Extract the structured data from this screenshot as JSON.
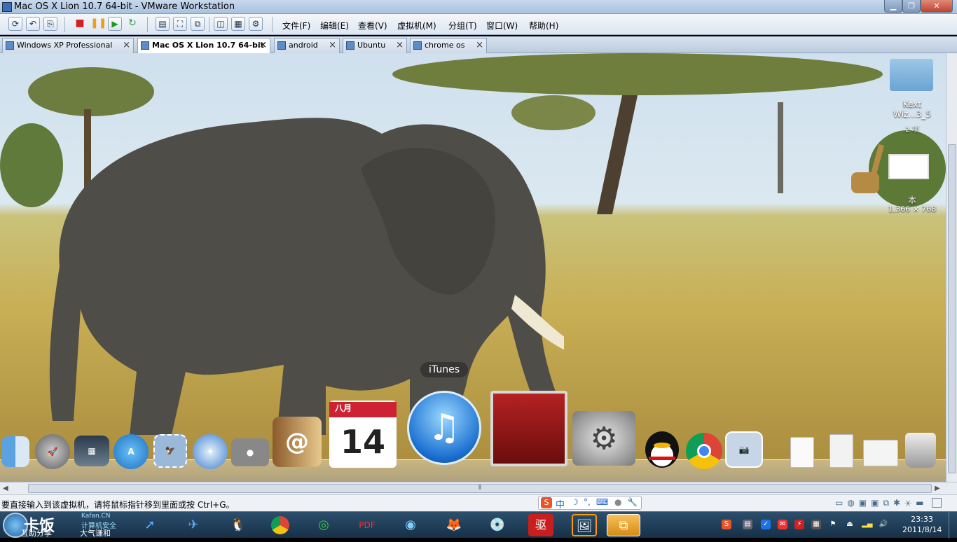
{
  "window": {
    "title": "Mac OS X Lion 10.7 64-bit - VMware Workstation",
    "controls": [
      "minimize",
      "maximize",
      "close"
    ]
  },
  "toolbar": {
    "menus": [
      "文件(F)",
      "编辑(E)",
      "查看(V)",
      "虚拟机(M)",
      "分组(T)",
      "窗口(W)",
      "帮助(H)"
    ]
  },
  "tabs": [
    {
      "label": "Windows XP Professional",
      "active": false
    },
    {
      "label": "Mac OS X Lion 10.7 64-bit",
      "active": true
    },
    {
      "label": "android",
      "active": false
    },
    {
      "label": "Ubuntu",
      "active": false
    },
    {
      "label": "chrome os",
      "active": false
    }
  ],
  "desktop": {
    "icons": [
      {
        "name": "folder",
        "label": "Kext Wiz...3_5",
        "sublabel": "2 项"
      },
      {
        "name": "screenshot",
        "label": "本",
        "sublabel": "1,366 × 768"
      }
    ],
    "dock_tooltip": "iTunes",
    "calendar": {
      "month": "八月",
      "day": "14"
    },
    "dock": [
      "finder-icon",
      "launchpad-icon",
      "mission-control-icon",
      "app-store-icon",
      "mail-stamp-icon",
      "safari-icon",
      "facetime-icon",
      "address-book-icon",
      "ical-icon",
      "itunes-icon",
      "photo-booth-icon",
      "system-preferences-icon",
      "qq-icon",
      "chrome-icon",
      "iphoto-icon",
      "document-icon",
      "document-icon-2",
      "preview-icon",
      "trash-icon"
    ]
  },
  "statusbar": {
    "hint": "要直接输入到该虚拟机，请将鼠标指针移到里面或按 Ctrl+G。",
    "ime": "中"
  },
  "taskbar": {
    "brand": "卡饭",
    "brand_sub": "Kafan.CN",
    "brand_line1": "计算机安全",
    "brand_line2": "互助分享",
    "brand_line3": "大气谦和",
    "time": "23:33",
    "date": "2011/8/14"
  }
}
